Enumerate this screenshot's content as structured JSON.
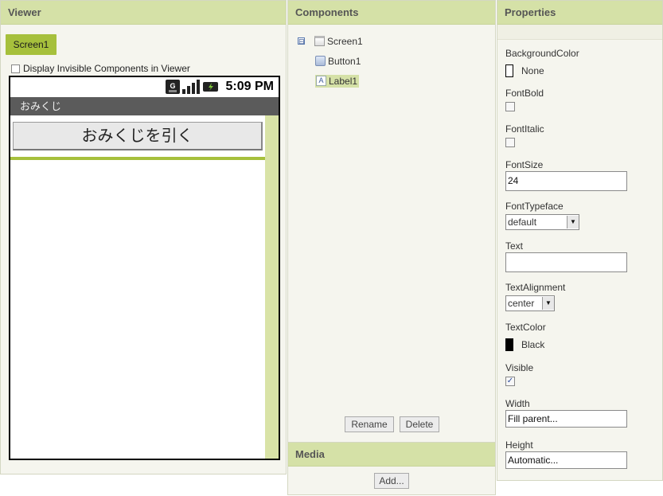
{
  "viewer": {
    "header": "Viewer",
    "screen_tab": "Screen1",
    "display_invisible_label": "Display Invisible Components in Viewer",
    "phone": {
      "time": "5:09 PM",
      "title": "おみくじ",
      "button_text": "おみくじを引く"
    }
  },
  "components": {
    "header": "Components",
    "tree": [
      {
        "label": "Screen1",
        "toggle": "⊟"
      },
      {
        "label": "Button1"
      },
      {
        "label": "Label1",
        "icon_text": "A"
      }
    ],
    "rename_label": "Rename",
    "delete_label": "Delete"
  },
  "media": {
    "header": "Media",
    "add_label": "Add..."
  },
  "properties": {
    "header": "Properties",
    "background_color": {
      "label": "BackgroundColor",
      "value": "None",
      "color": "#ffffff"
    },
    "font_bold": {
      "label": "FontBold",
      "checked": false
    },
    "font_italic": {
      "label": "FontItalic",
      "checked": false
    },
    "font_size": {
      "label": "FontSize",
      "value": "24"
    },
    "font_typeface": {
      "label": "FontTypeface",
      "value": "default"
    },
    "text": {
      "label": "Text",
      "value": ""
    },
    "text_alignment": {
      "label": "TextAlignment",
      "value": "center"
    },
    "text_color": {
      "label": "TextColor",
      "value": "Black",
      "color": "#000000"
    },
    "visible": {
      "label": "Visible",
      "checked": true,
      "mark": "✓"
    },
    "width": {
      "label": "Width",
      "value": "Fill parent..."
    },
    "height": {
      "label": "Height",
      "value": "Automatic..."
    }
  }
}
